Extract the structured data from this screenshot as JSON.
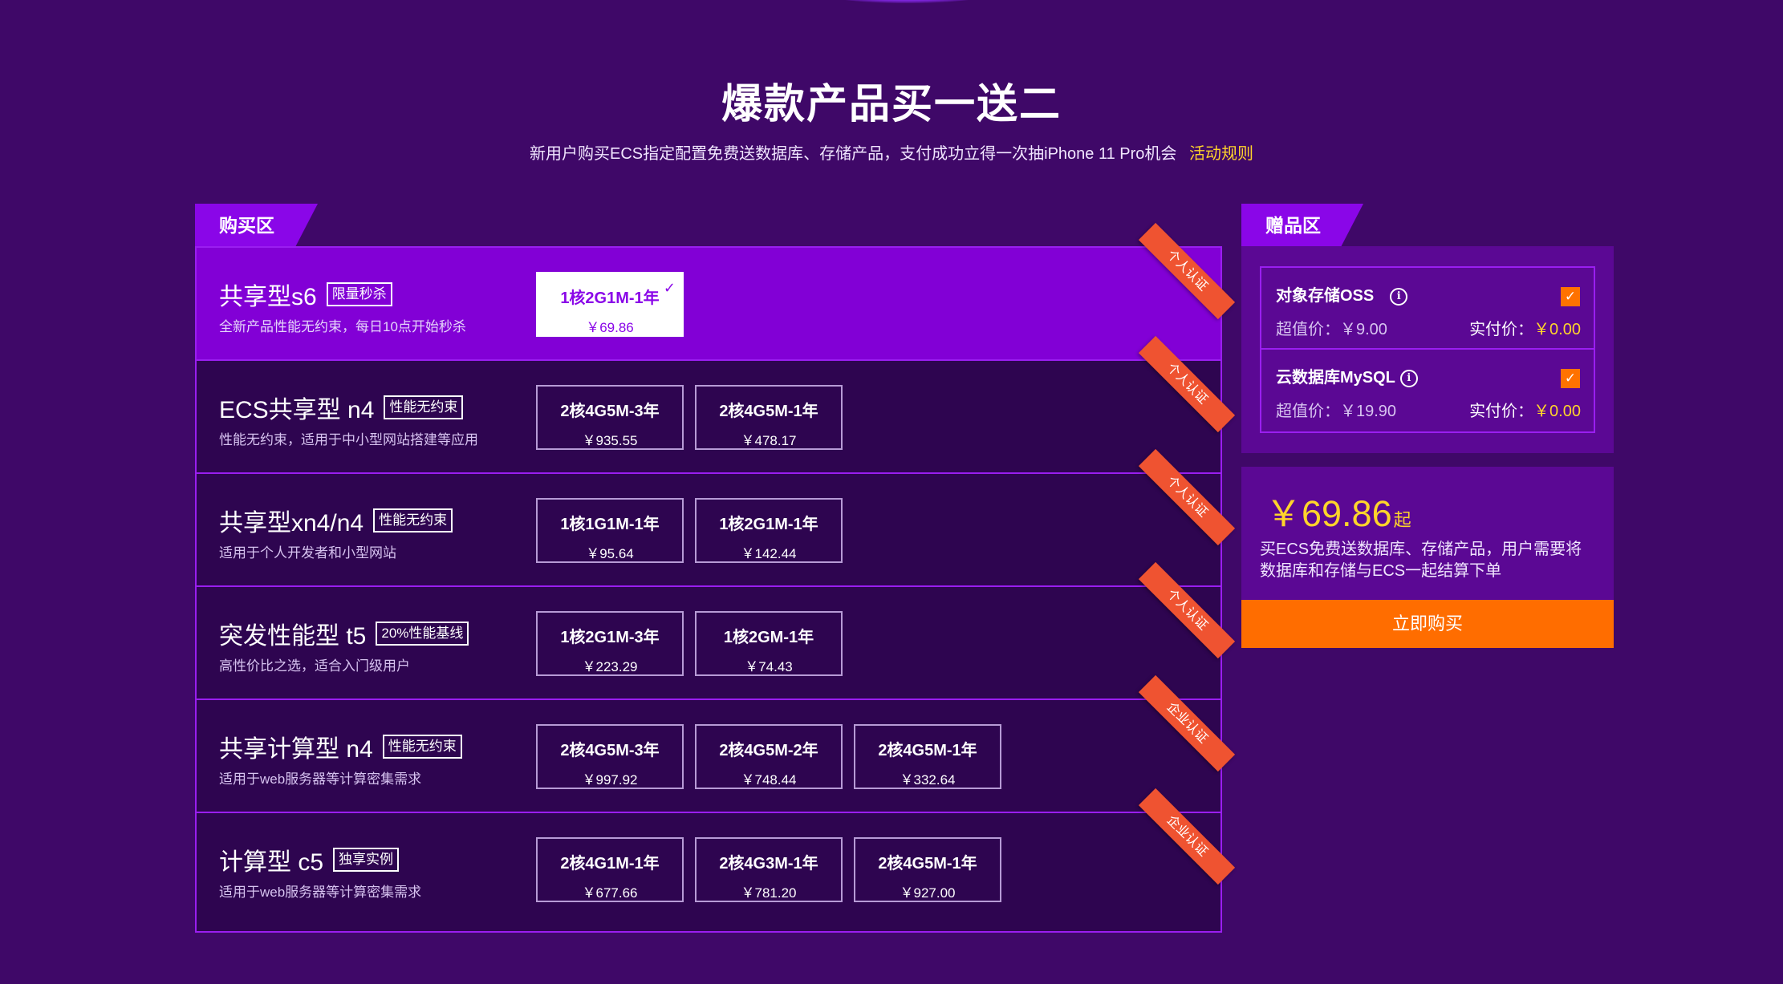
{
  "header": {
    "title": "爆款产品买一送二",
    "subtitle": "新用户购买ECS指定配置免费送数据库、存储产品，支付成功立得一次抽iPhone 11 Pro机会",
    "rules_link": "活动规则"
  },
  "tabs": {
    "buy": "购买区",
    "gift": "赠品区"
  },
  "products": [
    {
      "name": "共享型s6",
      "tag": "限量秒杀",
      "desc": "全新产品性能无约束，每日10点开始秒杀",
      "ribbon": "个人认证",
      "options": [
        {
          "spec": "1核2G1M-1年",
          "price": "￥69.86"
        }
      ]
    },
    {
      "name": "ECS共享型 n4",
      "tag": "性能无约束",
      "desc": "性能无约束，适用于中小型网站搭建等应用",
      "ribbon": "个人认证",
      "options": [
        {
          "spec": "2核4G5M-3年",
          "price": "￥935.55"
        },
        {
          "spec": "2核4G5M-1年",
          "price": "￥478.17"
        }
      ]
    },
    {
      "name": "共享型xn4/n4",
      "tag": "性能无约束",
      "desc": "适用于个人开发者和小型网站",
      "ribbon": "个人认证",
      "options": [
        {
          "spec": "1核1G1M-1年",
          "price": "￥95.64"
        },
        {
          "spec": "1核2G1M-1年",
          "price": "￥142.44"
        }
      ]
    },
    {
      "name": "突发性能型 t5",
      "tag": "20%性能基线",
      "desc": "高性价比之选，适合入门级用户",
      "ribbon": "个人认证",
      "options": [
        {
          "spec": "1核2G1M-3年",
          "price": "￥223.29"
        },
        {
          "spec": "1核2GM-1年",
          "price": "￥74.43"
        }
      ]
    },
    {
      "name": "共享计算型 n4",
      "tag": "性能无约束",
      "desc": "适用于web服务器等计算密集需求",
      "ribbon": "企业认证",
      "options": [
        {
          "spec": "2核4G5M-3年",
          "price": "￥997.92"
        },
        {
          "spec": "2核4G5M-2年",
          "price": "￥748.44"
        },
        {
          "spec": "2核4G5M-1年",
          "price": "￥332.64"
        }
      ]
    },
    {
      "name": "计算型 c5",
      "tag": "独享实例",
      "desc": "适用于web服务器等计算密集需求",
      "ribbon": "企业认证",
      "options": [
        {
          "spec": "2核4G1M-1年",
          "price": "￥677.66"
        },
        {
          "spec": "2核4G3M-1年",
          "price": "￥781.20"
        },
        {
          "spec": "2核4G5M-1年",
          "price": "￥927.00"
        }
      ]
    }
  ],
  "gifts": [
    {
      "name": "对象存储OSS",
      "info_icon": "i",
      "checked": true,
      "value_label": "超值价：￥9.00",
      "actual_label": "实付价：",
      "actual_value": "￥0.00"
    },
    {
      "name": "云数据库MySQL",
      "info_icon": "i",
      "checked": true,
      "value_label": "超值价：￥19.90",
      "actual_label": "实付价：",
      "actual_value": "￥0.00"
    }
  ],
  "summary": {
    "price": "￥69.86",
    "price_suffix": "起",
    "desc": "买ECS免费送数据库、存储产品，用户需要将数据库和存储与ECS一起结算下单",
    "buy_button": "立即购买"
  },
  "icons": {
    "check": "✓",
    "info": "info-circle",
    "checkbox": "✓"
  },
  "colors": {
    "background": "#3f0868",
    "accent": "#8a06e8",
    "highlight": "#ffd42b",
    "ribbon": "#ef5331",
    "buy_button": "#ff6d00"
  }
}
